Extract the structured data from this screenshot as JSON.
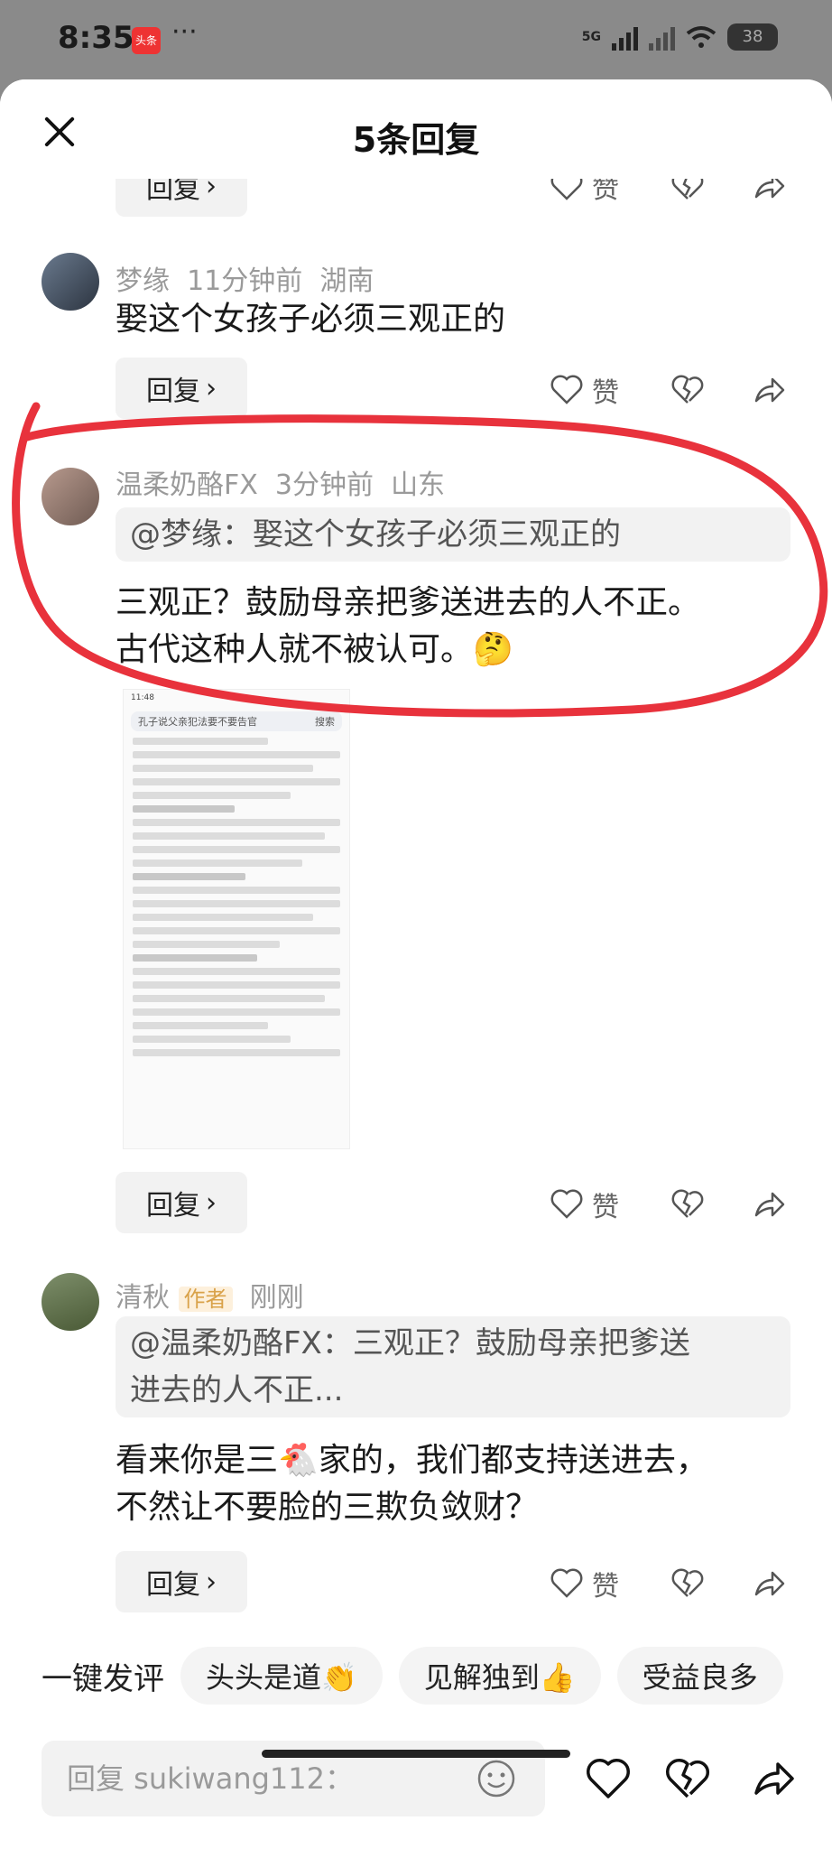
{
  "status_bar": {
    "time": "8:35",
    "app_badge": "头条",
    "more": "···",
    "network": "5G",
    "battery": "38"
  },
  "header": {
    "title": "5条回复",
    "close_icon": "close-icon"
  },
  "comments": [
    {
      "reply_label": "回复",
      "like_label": "赞"
    },
    {
      "user": "梦缘",
      "time": "11分钟前",
      "location": "湖南",
      "text": "娶这个女孩子必须三观正的",
      "reply_label": "回复",
      "like_label": "赞"
    },
    {
      "user": "温柔奶酪FX",
      "time": "3分钟前",
      "location": "山东",
      "quote_user": "@梦缘：",
      "quote_text": "娶这个女孩子必须三观正的",
      "text_line1": "三观正？鼓励母亲把爹送进去的人不正。",
      "text_line2": "古代这种人就不被认可。",
      "text_emoji": "🤔",
      "reply_label": "回复",
      "like_label": "赞"
    },
    {
      "user": "清秋",
      "tag": "作者",
      "time": "刚刚",
      "quote_line1": "@温柔奶酪FX：三观正？鼓励母亲把爹送",
      "quote_line2": "进去的人不正...",
      "text_line1a": "看来你是三",
      "text_emoji": "🐔",
      "text_line1b": "家的，我们都支持送进去，",
      "text_line2": "不然让不要脸的三欺负敛财？",
      "reply_label": "回复",
      "like_label": "赞"
    }
  ],
  "embedded_screenshot": {
    "search": "孔子说父亲犯法要不要告官",
    "search_btn": "搜索",
    "time": "11:48"
  },
  "quick_comment": {
    "label": "一键发评",
    "chips": [
      "头头是道👏",
      "见解独到👍",
      "受益良多"
    ]
  },
  "composer": {
    "placeholder": "回复 sukiwang112："
  },
  "colors": {
    "annotation_red": "#e8323c"
  }
}
